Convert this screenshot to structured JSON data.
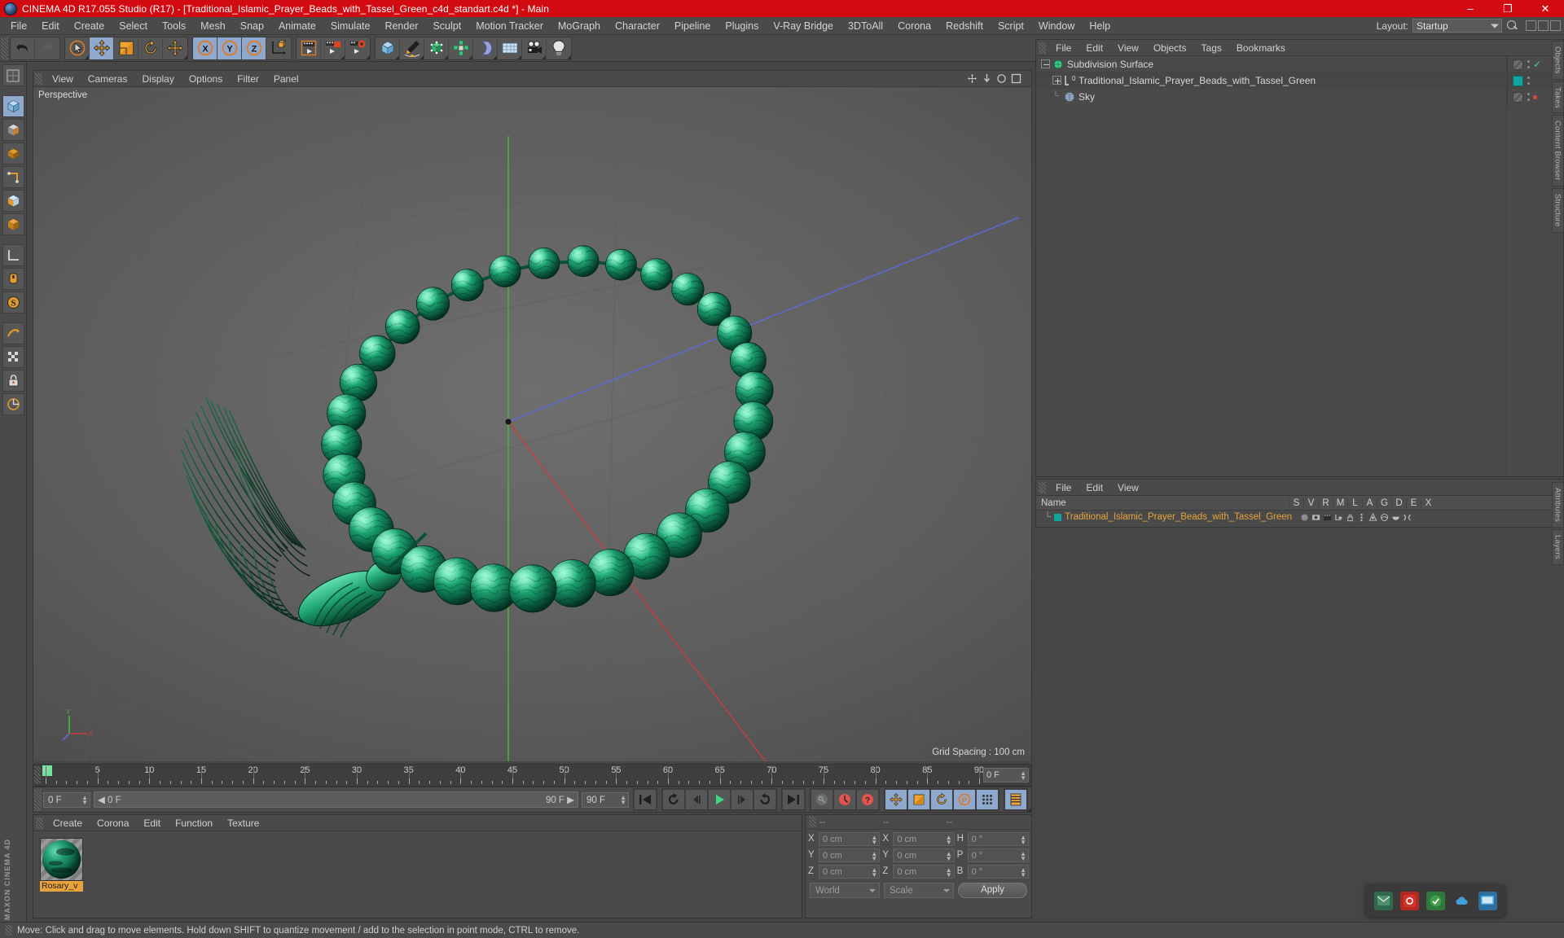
{
  "window": {
    "title": "CINEMA 4D R17.055 Studio (R17) - [Traditional_Islamic_Prayer_Beads_with_Tassel_Green_c4d_standart.c4d *] - Main",
    "minimize": "–",
    "maximize": "❐",
    "close": "✕"
  },
  "menubar": {
    "items": [
      "File",
      "Edit",
      "Create",
      "Select",
      "Tools",
      "Mesh",
      "Snap",
      "Animate",
      "Simulate",
      "Render",
      "Sculpt",
      "Motion Tracker",
      "MoGraph",
      "Character",
      "Pipeline",
      "Plugins",
      "V-Ray Bridge",
      "3DToAll",
      "Corona",
      "Redshift",
      "Script",
      "Window",
      "Help"
    ],
    "layout_label": "Layout:",
    "layout_value": "Startup"
  },
  "viewport": {
    "menu": [
      "View",
      "Cameras",
      "Display",
      "Options",
      "Filter",
      "Panel"
    ],
    "camera_label": "Perspective",
    "grid_spacing": "Grid Spacing : 100 cm"
  },
  "object_manager": {
    "menu": [
      "File",
      "Edit",
      "View",
      "Objects",
      "Tags",
      "Bookmarks"
    ],
    "rows": [
      {
        "name": "Subdivision Surface",
        "depth": 0,
        "icon": "subdivision-surface-icon",
        "tag_swatch": "off",
        "state": "check"
      },
      {
        "name": "Traditional_Islamic_Prayer_Beads_with_Tassel_Green",
        "depth": 1,
        "icon": "null-object-icon",
        "tag_swatch": "teal",
        "state": "none"
      },
      {
        "name": "Sky",
        "depth": 1,
        "icon": "sky-icon",
        "tag_swatch": "off",
        "state": "red"
      }
    ]
  },
  "material_manager": {
    "menu": [
      "File",
      "Edit",
      "View"
    ],
    "columns": [
      "Name",
      "S",
      "V",
      "R",
      "M",
      "L",
      "A",
      "G",
      "D",
      "E",
      "X"
    ],
    "rows": [
      {
        "name": "Traditional_Islamic_Prayer_Beads_with_Tassel_Green"
      }
    ]
  },
  "side_tabs": [
    "Objects",
    "Takes",
    "Content Browser",
    "Structure",
    "Attributes",
    "Layers"
  ],
  "timeline": {
    "ticks": [
      0,
      5,
      10,
      15,
      20,
      25,
      30,
      35,
      40,
      45,
      50,
      55,
      60,
      65,
      70,
      75,
      80,
      85,
      90
    ],
    "min": 0,
    "max": 90,
    "current_frame_field": "0 F"
  },
  "transport": {
    "current_frame": "0 F",
    "range_start": "0 F",
    "range_end": "90 F",
    "end_field": "90 F"
  },
  "material_browser": {
    "menu": [
      "Create",
      "Corona",
      "Edit",
      "Function",
      "Texture"
    ],
    "materials": [
      {
        "name": "Rosary_v",
        "swatch": "green-marble"
      }
    ]
  },
  "coordinates": {
    "header": [
      "--",
      "--",
      "--"
    ],
    "position": {
      "x_label": "X",
      "x": "0 cm",
      "y_label": "Y",
      "y": "0 cm",
      "z_label": "Z",
      "z": "0 cm"
    },
    "size": {
      "x_label": "X",
      "x": "0 cm",
      "y_label": "Y",
      "y": "0 cm",
      "z_label": "Z",
      "z": "0 cm"
    },
    "rotation": {
      "h_label": "H",
      "h": "0 °",
      "p_label": "P",
      "p": "0 °",
      "b_label": "B",
      "b": "0 °"
    },
    "space": "World",
    "mode": "Scale",
    "apply": "Apply"
  },
  "status_bar": {
    "message": "Move: Click and drag to move elements. Hold down SHIFT to quantize movement / add to the selection in point mode, CTRL to remove."
  },
  "branding": {
    "maxon": "MAXON CINEMA 4D"
  },
  "colors": {
    "title_red": "#d20a11",
    "panel_gray": "#4a4a4a",
    "selection_blue": "#8fa8ce",
    "accent_orange": "#e8a33c",
    "bead_green": "#15a06f",
    "tag_teal": "#12a5a0"
  }
}
